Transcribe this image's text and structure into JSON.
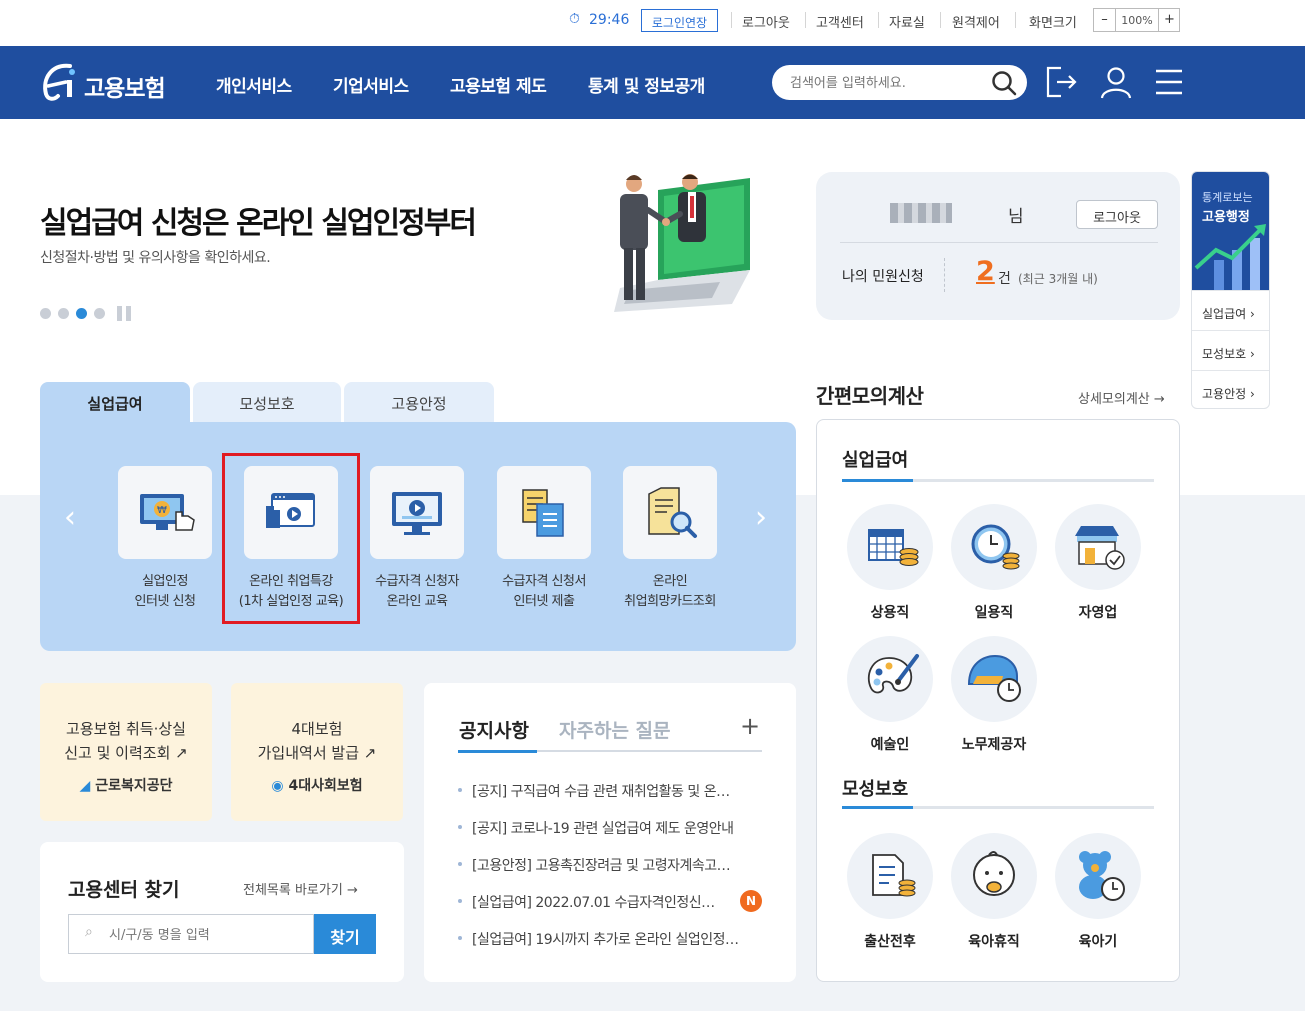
{
  "topbar": {
    "timer": "29:46",
    "extend_login": "로그인연장",
    "logout": "로그아웃",
    "customer_center": "고객센터",
    "archive": "자료실",
    "remote": "원격제어",
    "screen_size": "화면크기",
    "zoom_minus": "–",
    "zoom_value": "100%",
    "zoom_plus": "+"
  },
  "gnb": {
    "logo_text": "고용보험",
    "menus": [
      "개인서비스",
      "기업서비스",
      "고용보험 제도",
      "통계 및 정보공개"
    ],
    "search_placeholder": "검색어를 입력하세요."
  },
  "hero": {
    "title": "실업급여 신청은 온라인 실업인정부터",
    "subtitle": "신청절차·방법 및 유의사항을 확인하세요."
  },
  "login_box": {
    "user_suffix": "님",
    "logout_button": "로그아웃",
    "my_request_label": "나의 민원신청",
    "request_count": "2",
    "request_unit": "건",
    "request_period": "(최근 3개월 내)"
  },
  "quick_menu": {
    "banner_line1": "통계로보는",
    "banner_line2": "고용행정",
    "items": [
      "실업급여 ›",
      "모성보호 ›",
      "고용안정 ›"
    ]
  },
  "tabs": [
    "실업급여",
    "모성보호",
    "고용안정"
  ],
  "services": [
    {
      "line1": "실업인정",
      "line2": "인터넷 신청"
    },
    {
      "line1": "온라인 취업특강",
      "line2": "(1차 실업인정 교육)"
    },
    {
      "line1": "수급자격 신청자",
      "line2": "온라인 교육"
    },
    {
      "line1": "수급자격 신청서",
      "line2": "인터넷 제출"
    },
    {
      "line1": "온라인",
      "line2": "취업희망카드조회"
    }
  ],
  "yellow_cards": [
    {
      "line1": "고용보험 취득·상실",
      "line2": "신고 및 이력조회",
      "org": "근로복지공단"
    },
    {
      "line1": "4대보험",
      "line2": "가입내역서 발급",
      "org": "4대사회보험"
    }
  ],
  "center_search": {
    "title": "고용센터 찾기",
    "all_link": "전체목록 바로가기",
    "placeholder": "시/구/동 명을 입력",
    "button": "찾기"
  },
  "notices": {
    "tab_active": "공지사항",
    "tab_inactive": "자주하는 질문",
    "more": "+",
    "new_badge": "N",
    "items": [
      "[공지] 구직급여 수급 관련 재취업활동 및 온…",
      "[공지] 코로나-19 관련 실업급여 제도 운영안내",
      "[고용안정] 고용촉진장려금 및 고령자계속고…",
      "[실업급여] 2022.07.01 수급자격인정신…",
      "[실업급여] 19시까지 추가로 온라인 실업인정…"
    ]
  },
  "calc": {
    "title": "간편모의계산",
    "detail_link": "상세모의계산",
    "section1": "실업급여",
    "section1_items": [
      "상용직",
      "일용직",
      "자영업",
      "예술인",
      "노무제공자"
    ],
    "section2": "모성보호",
    "section2_items": [
      "출산전후",
      "육아휴직",
      "육아기"
    ]
  }
}
